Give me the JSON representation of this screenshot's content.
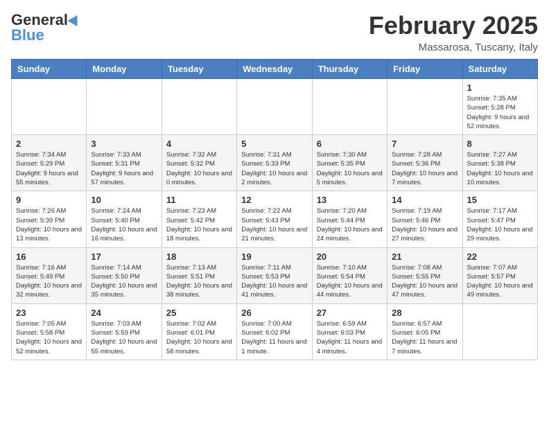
{
  "logo": {
    "general": "General",
    "blue": "Blue"
  },
  "header": {
    "month": "February 2025",
    "location": "Massarosa, Tuscany, Italy"
  },
  "weekdays": [
    "Sunday",
    "Monday",
    "Tuesday",
    "Wednesday",
    "Thursday",
    "Friday",
    "Saturday"
  ],
  "weeks": [
    [
      {
        "day": "",
        "info": ""
      },
      {
        "day": "",
        "info": ""
      },
      {
        "day": "",
        "info": ""
      },
      {
        "day": "",
        "info": ""
      },
      {
        "day": "",
        "info": ""
      },
      {
        "day": "",
        "info": ""
      },
      {
        "day": "1",
        "info": "Sunrise: 7:35 AM\nSunset: 5:28 PM\nDaylight: 9 hours and 52 minutes."
      }
    ],
    [
      {
        "day": "2",
        "info": "Sunrise: 7:34 AM\nSunset: 5:29 PM\nDaylight: 9 hours and 55 minutes."
      },
      {
        "day": "3",
        "info": "Sunrise: 7:33 AM\nSunset: 5:31 PM\nDaylight: 9 hours and 57 minutes."
      },
      {
        "day": "4",
        "info": "Sunrise: 7:32 AM\nSunset: 5:32 PM\nDaylight: 10 hours and 0 minutes."
      },
      {
        "day": "5",
        "info": "Sunrise: 7:31 AM\nSunset: 5:33 PM\nDaylight: 10 hours and 2 minutes."
      },
      {
        "day": "6",
        "info": "Sunrise: 7:30 AM\nSunset: 5:35 PM\nDaylight: 10 hours and 5 minutes."
      },
      {
        "day": "7",
        "info": "Sunrise: 7:28 AM\nSunset: 5:36 PM\nDaylight: 10 hours and 7 minutes."
      },
      {
        "day": "8",
        "info": "Sunrise: 7:27 AM\nSunset: 5:38 PM\nDaylight: 10 hours and 10 minutes."
      }
    ],
    [
      {
        "day": "9",
        "info": "Sunrise: 7:26 AM\nSunset: 5:39 PM\nDaylight: 10 hours and 13 minutes."
      },
      {
        "day": "10",
        "info": "Sunrise: 7:24 AM\nSunset: 5:40 PM\nDaylight: 10 hours and 16 minutes."
      },
      {
        "day": "11",
        "info": "Sunrise: 7:23 AM\nSunset: 5:42 PM\nDaylight: 10 hours and 18 minutes."
      },
      {
        "day": "12",
        "info": "Sunrise: 7:22 AM\nSunset: 5:43 PM\nDaylight: 10 hours and 21 minutes."
      },
      {
        "day": "13",
        "info": "Sunrise: 7:20 AM\nSunset: 5:44 PM\nDaylight: 10 hours and 24 minutes."
      },
      {
        "day": "14",
        "info": "Sunrise: 7:19 AM\nSunset: 5:46 PM\nDaylight: 10 hours and 27 minutes."
      },
      {
        "day": "15",
        "info": "Sunrise: 7:17 AM\nSunset: 5:47 PM\nDaylight: 10 hours and 29 minutes."
      }
    ],
    [
      {
        "day": "16",
        "info": "Sunrise: 7:16 AM\nSunset: 5:49 PM\nDaylight: 10 hours and 32 minutes."
      },
      {
        "day": "17",
        "info": "Sunrise: 7:14 AM\nSunset: 5:50 PM\nDaylight: 10 hours and 35 minutes."
      },
      {
        "day": "18",
        "info": "Sunrise: 7:13 AM\nSunset: 5:51 PM\nDaylight: 10 hours and 38 minutes."
      },
      {
        "day": "19",
        "info": "Sunrise: 7:11 AM\nSunset: 5:53 PM\nDaylight: 10 hours and 41 minutes."
      },
      {
        "day": "20",
        "info": "Sunrise: 7:10 AM\nSunset: 5:54 PM\nDaylight: 10 hours and 44 minutes."
      },
      {
        "day": "21",
        "info": "Sunrise: 7:08 AM\nSunset: 5:55 PM\nDaylight: 10 hours and 47 minutes."
      },
      {
        "day": "22",
        "info": "Sunrise: 7:07 AM\nSunset: 5:57 PM\nDaylight: 10 hours and 49 minutes."
      }
    ],
    [
      {
        "day": "23",
        "info": "Sunrise: 7:05 AM\nSunset: 5:58 PM\nDaylight: 10 hours and 52 minutes."
      },
      {
        "day": "24",
        "info": "Sunrise: 7:03 AM\nSunset: 5:59 PM\nDaylight: 10 hours and 55 minutes."
      },
      {
        "day": "25",
        "info": "Sunrise: 7:02 AM\nSunset: 6:01 PM\nDaylight: 10 hours and 58 minutes."
      },
      {
        "day": "26",
        "info": "Sunrise: 7:00 AM\nSunset: 6:02 PM\nDaylight: 11 hours and 1 minute."
      },
      {
        "day": "27",
        "info": "Sunrise: 6:59 AM\nSunset: 6:03 PM\nDaylight: 11 hours and 4 minutes."
      },
      {
        "day": "28",
        "info": "Sunrise: 6:57 AM\nSunset: 6:05 PM\nDaylight: 11 hours and 7 minutes."
      },
      {
        "day": "",
        "info": ""
      }
    ]
  ]
}
